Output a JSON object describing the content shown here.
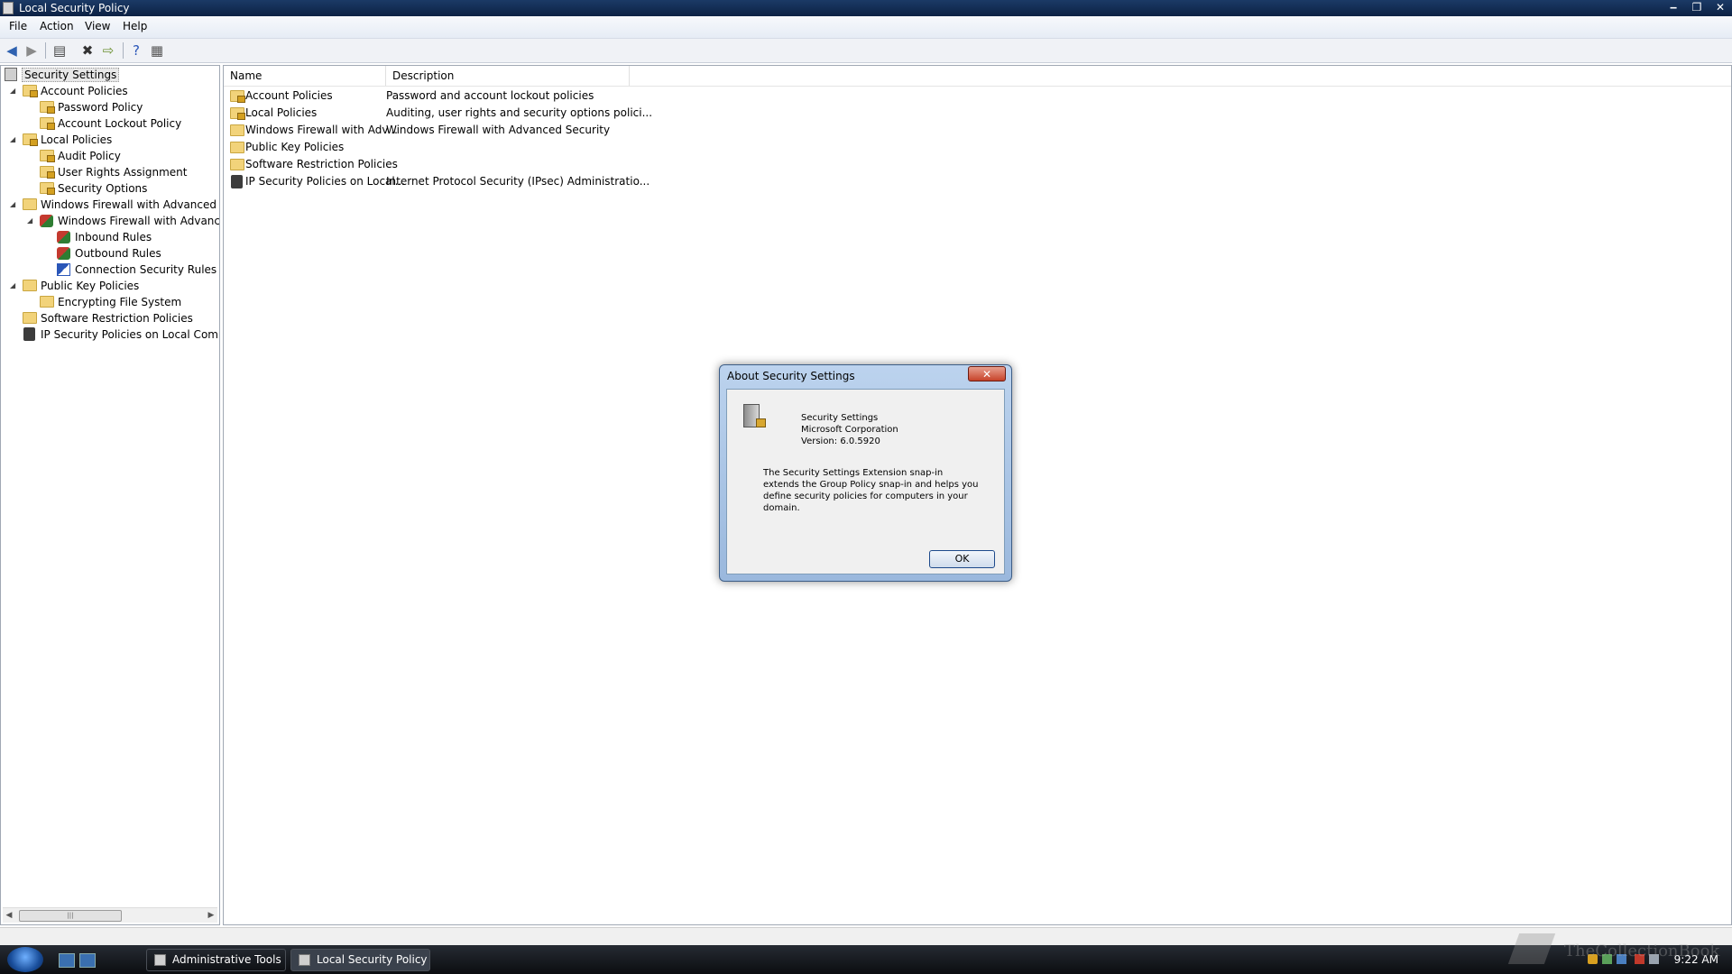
{
  "window": {
    "title": "Local Security Policy",
    "controls": [
      "‒",
      "❐",
      "✕"
    ]
  },
  "menu": [
    "File",
    "Action",
    "View",
    "Help"
  ],
  "tree": {
    "root": "Security Settings",
    "items": [
      {
        "label": "Account Policies",
        "expanded": true
      },
      {
        "label": "Password Policy"
      },
      {
        "label": "Account Lockout Policy"
      },
      {
        "label": "Local Policies",
        "expanded": true
      },
      {
        "label": "Audit Policy"
      },
      {
        "label": "User Rights Assignment"
      },
      {
        "label": "Security Options"
      },
      {
        "label": "Windows Firewall with Advanced Secu",
        "expanded": true
      },
      {
        "label": "Windows Firewall with Advanced",
        "expanded": true
      },
      {
        "label": "Inbound Rules"
      },
      {
        "label": "Outbound Rules"
      },
      {
        "label": "Connection Security Rules"
      },
      {
        "label": "Public Key Policies",
        "expanded": true
      },
      {
        "label": "Encrypting File System"
      },
      {
        "label": "Software Restriction Policies"
      },
      {
        "label": "IP Security Policies on Local Compute"
      }
    ]
  },
  "list": {
    "columns": [
      "Name",
      "Description"
    ],
    "rows": [
      {
        "name": "Account Policies",
        "description": "Password and account lockout policies"
      },
      {
        "name": "Local Policies",
        "description": "Auditing, user rights and security options polici..."
      },
      {
        "name": "Windows Firewall with Adv...",
        "description": "Windows Firewall with Advanced Security"
      },
      {
        "name": "Public Key Policies",
        "description": ""
      },
      {
        "name": "Software Restriction Policies",
        "description": ""
      },
      {
        "name": "IP Security Policies on Local...",
        "description": "Internet Protocol Security (IPsec) Administratio..."
      }
    ]
  },
  "dialog": {
    "title": "About Security Settings",
    "close": "✕",
    "product": "Security Settings",
    "company": "Microsoft Corporation",
    "version": "Version: 6.0.5920",
    "description": "The Security Settings Extension snap-in extends the Group Policy snap-in and helps you define security policies for computers in your domain.",
    "ok": "OK"
  },
  "taskbar": {
    "buttons": [
      "Administrative Tools",
      "Local Security Policy"
    ],
    "clock": "9:22 AM"
  },
  "watermark": "TheCollectionBook"
}
